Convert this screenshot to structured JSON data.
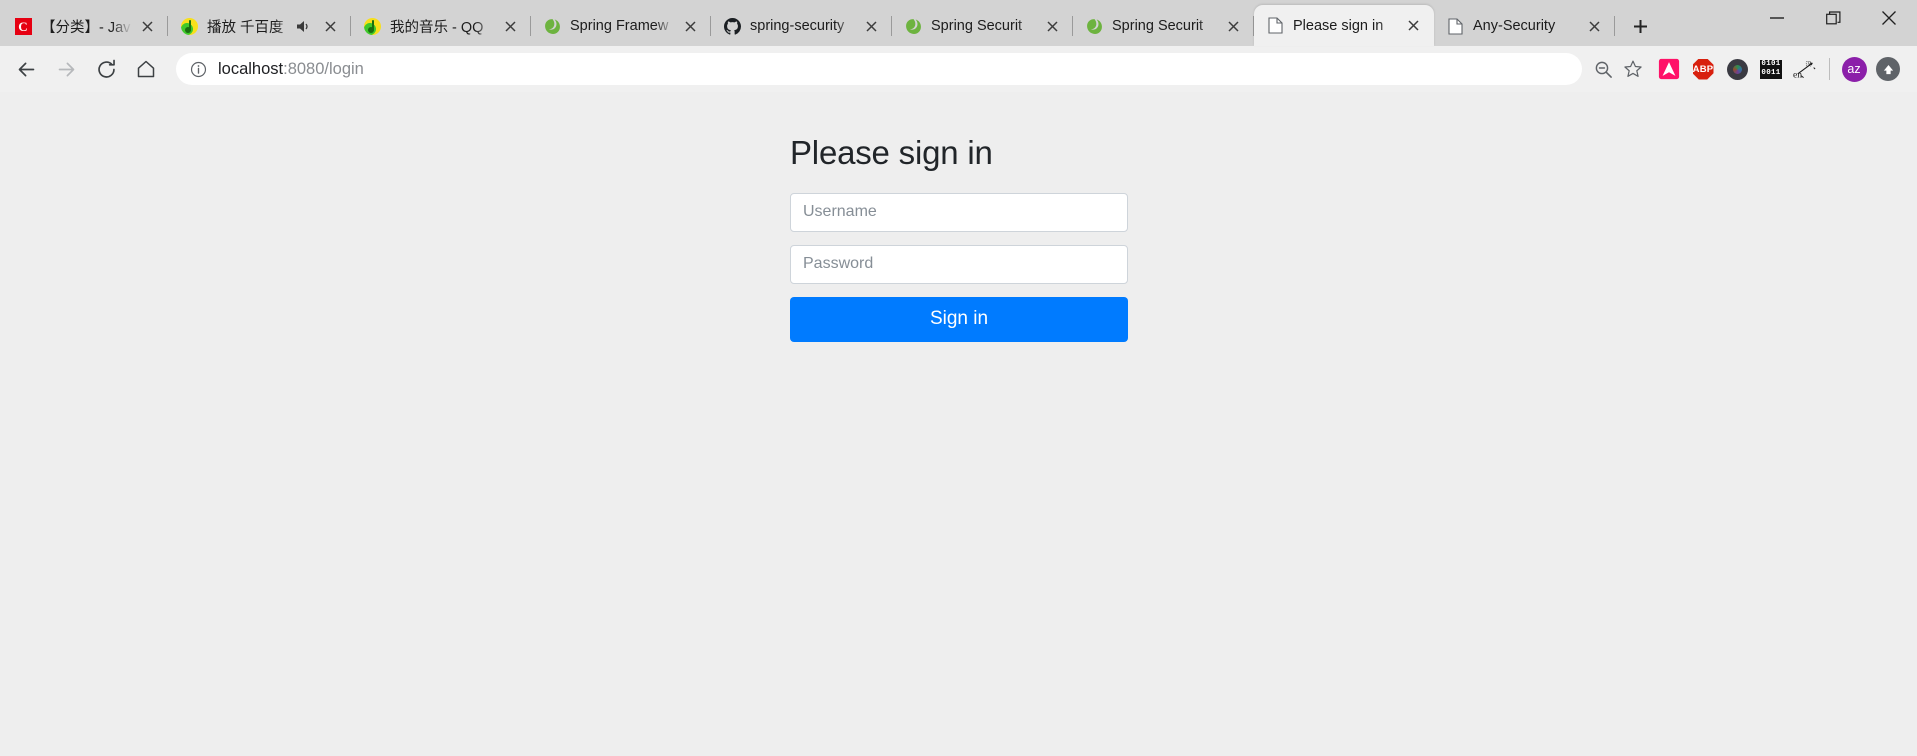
{
  "window": {
    "minimize_label": "Minimize",
    "maximize_label": "Maximize",
    "close_label": "Close"
  },
  "tabstrip": {
    "newtab_label": "New tab",
    "tabs": [
      {
        "title": "【分类】- Jav",
        "favicon": "csdn-icon",
        "active": false,
        "audio": false
      },
      {
        "title": "播放 千百度",
        "favicon": "qqmusic-icon",
        "active": false,
        "audio": true
      },
      {
        "title": "我的音乐 - QQ",
        "favicon": "qqmusic-icon",
        "active": false,
        "audio": false
      },
      {
        "title": "Spring Framew",
        "favicon": "spring-leaf-icon",
        "active": false,
        "audio": false
      },
      {
        "title": "spring-security",
        "favicon": "github-icon",
        "active": false,
        "audio": false
      },
      {
        "title": "Spring Securit",
        "favicon": "spring-leaf-icon",
        "active": false,
        "audio": false
      },
      {
        "title": "Spring Securit",
        "favicon": "spring-leaf-icon",
        "active": false,
        "audio": false
      },
      {
        "title": "Please sign in",
        "favicon": "page-icon",
        "active": true,
        "audio": false
      },
      {
        "title": "Any-Security",
        "favicon": "page-icon",
        "active": false,
        "audio": false
      }
    ]
  },
  "toolbar": {
    "back_label": "Back",
    "forward_label": "Forward",
    "reload_label": "Reload",
    "home_label": "Home",
    "url_host": "localhost",
    "url_rest": ":8080/login",
    "url_full": "localhost:8080/login",
    "site_info_label": "View site information",
    "zoom_out_label": "Zoom out",
    "bookmark_label": "Bookmark this page",
    "extensions": [
      {
        "name": "avast-icon",
        "label": ""
      },
      {
        "name": "adblock-plus-icon",
        "label": "ABP"
      },
      {
        "name": "camera-icon",
        "label": ""
      },
      {
        "name": "binary-icon",
        "label_top": "0101",
        "label_bottom": "0011"
      },
      {
        "name": "translate-icon",
        "label": "en"
      }
    ],
    "profile_label": "az",
    "menu_label": "Customize and control"
  },
  "page": {
    "title": "Please sign in",
    "username_placeholder": "Username",
    "username_value": "",
    "password_placeholder": "Password",
    "password_value": "",
    "signin_label": "Sign in",
    "accent_color": "#007bff",
    "background_color": "#eeeeee"
  }
}
